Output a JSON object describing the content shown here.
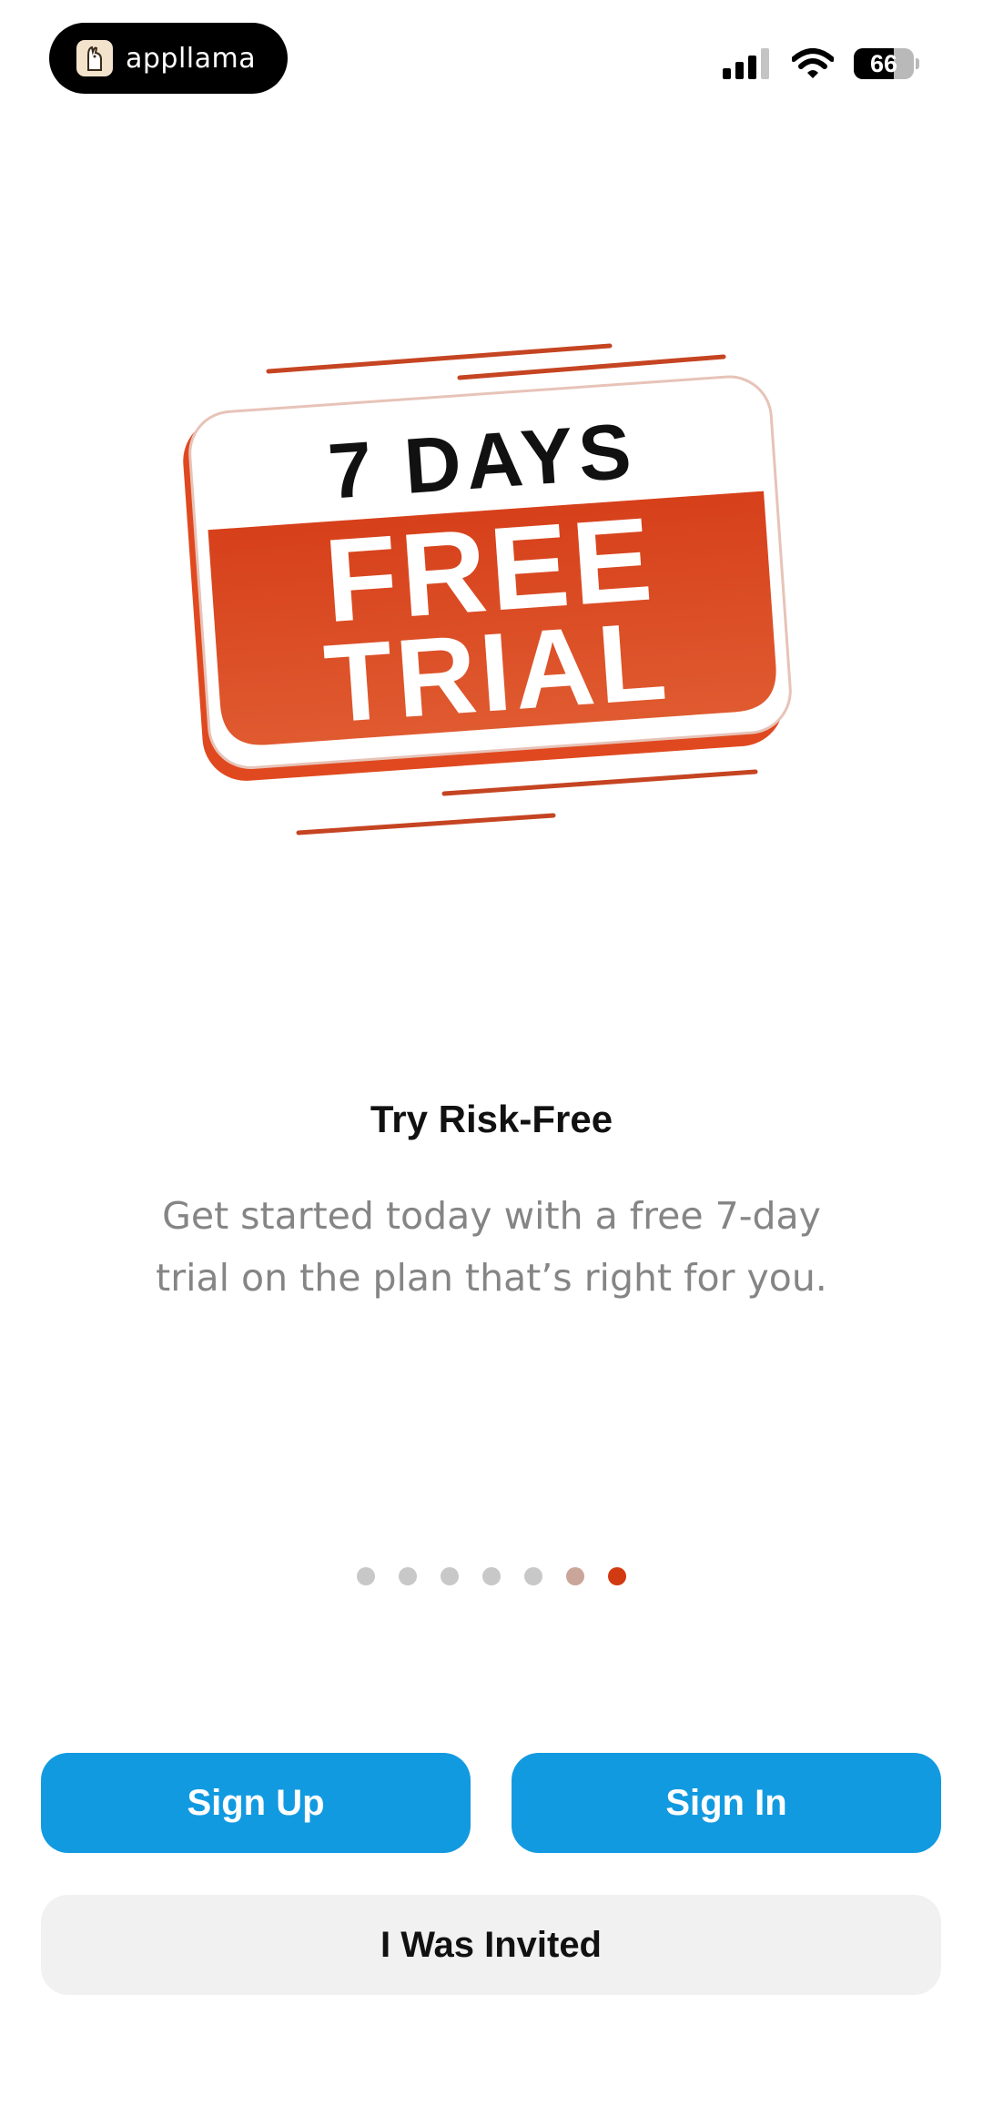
{
  "status_bar": {
    "app_name": "appllama",
    "battery_level": "66",
    "battery_fraction": 0.66,
    "signal_icon": "cellular-signal-icon",
    "wifi_icon": "wifi-icon"
  },
  "hero": {
    "line1": "7 DAYS",
    "line2": "FREE",
    "line3": "TRIAL",
    "colors": {
      "accent": "#d9441c",
      "accent_light": "#e36b3a",
      "stripe": "#c54422"
    }
  },
  "content": {
    "title": "Try Risk-Free",
    "description": "Get started today with a free 7-day trial on the plan that’s right for you."
  },
  "pagination": {
    "total": 7,
    "active_index": 6,
    "dot_colors": [
      "#c8c8c8",
      "#c8c8c8",
      "#c8c8c8",
      "#c8c8c8",
      "#c8c8c8",
      "#c9a59a",
      "#d23a12"
    ]
  },
  "actions": {
    "sign_up_label": "Sign Up",
    "sign_in_label": "Sign In",
    "invited_label": "I Was Invited",
    "colors": {
      "primary": "#129ae0",
      "secondary": "#f1f1f1"
    }
  }
}
